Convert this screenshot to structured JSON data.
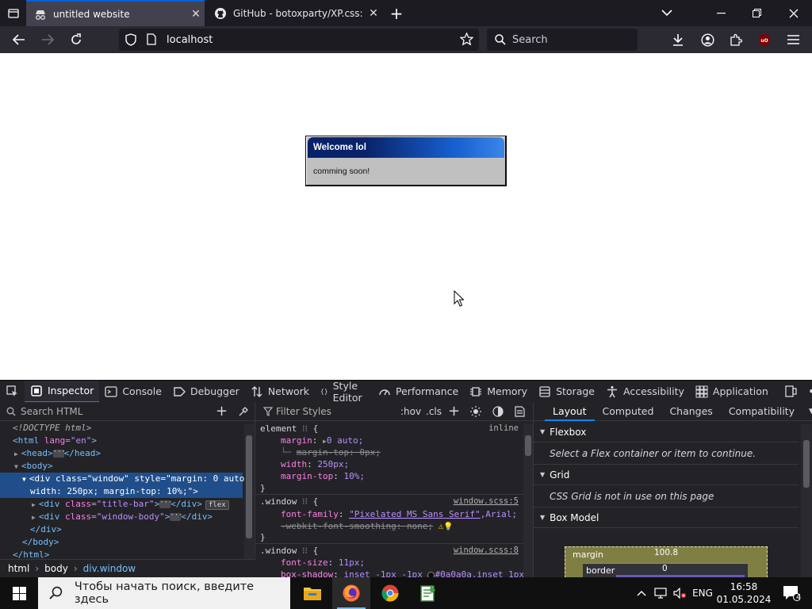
{
  "browser": {
    "tabs": [
      {
        "title": "untitled website",
        "active": true
      },
      {
        "title": "GitHub - botoxparty/XP.css: A C",
        "active": false
      }
    ],
    "url": "localhost",
    "search_placeholder": "Search"
  },
  "page": {
    "window_title": "Welcome lol",
    "window_body": "comming soon!"
  },
  "devtools": {
    "tools": [
      "Inspector",
      "Console",
      "Debugger",
      "Network",
      "Style Editor",
      "Performance",
      "Memory",
      "Storage",
      "Accessibility",
      "Application"
    ],
    "search_html_placeholder": "Search HTML",
    "filter_styles_placeholder": "Filter Styles",
    "hov": ":hov",
    "cls": ".cls",
    "markup": {
      "doctype": "<!DOCTYPE html>",
      "html_open": "<html",
      "html_lang_attr": "lang",
      "html_lang_val": "\"en\"",
      "head": "<head>",
      "head_close": "</head>",
      "body_open": "<body>",
      "div_open": "<div",
      "class_attr": "class",
      "window_class": "\"window\"",
      "style_attr": "style",
      "style_val_1": "\"margin: 0 auto;",
      "style_val_2": "width: 250px; margin-top: 10%;\">",
      "titlebar_class": "\"title-bar\"",
      "windowbody_class": "\"window-body\"",
      "div_close": "</div>",
      "flex_badge": "flex",
      "body_close": "</body>",
      "html_close": "</html>"
    },
    "breadcrumbs": [
      "html",
      "body",
      "div.window"
    ],
    "rules": {
      "element_selector": "element",
      "element_source": "inline",
      "margin_name": "margin",
      "margin_val": "0 auto;",
      "margin_top_struck": "margin-top: 0px;",
      "width_name": "width",
      "width_val": "250px;",
      "margin_top_name": "margin-top",
      "margin_top_val": "10%;",
      "window_selector": ".window",
      "window_src_1": "window.scss:5",
      "font_family_name": "font-family",
      "font_family_val_link": "\"Pixelated MS Sans Serif\"",
      "font_family_val_rest": ",Arial;",
      "webkit_smoothing": "-webkit-font-smoothing: none;",
      "window_src_2": "window.scss:8",
      "font_size_name": "font-size",
      "font_size_val": "11px;",
      "box_shadow_name": "box-shadow",
      "box_shadow_val": "inset -1px -1px",
      "box_shadow_color": "#0a0a0a",
      "box_shadow_rest": ",inset 1px"
    },
    "layout_tabs": [
      "Layout",
      "Computed",
      "Changes",
      "Compatibility"
    ],
    "layout": {
      "flexbox_title": "Flexbox",
      "flexbox_msg": "Select a Flex container or item to continue.",
      "grid_title": "Grid",
      "grid_msg": "CSS Grid is not in use on this page",
      "boxmodel_title": "Box Model",
      "margin_label": "margin",
      "margin_value": "100.8",
      "border_label": "border",
      "border_value": "0"
    }
  },
  "taskbar": {
    "search_placeholder": "Чтобы начать поиск, введите здесь",
    "lang": "ENG",
    "time": "16:58",
    "date": "01.05.2024",
    "notifications": "4"
  },
  "colors": {
    "accent": "#0a84ff",
    "xp_title_start": "#0a246a",
    "xp_title_end": "#3a86e8",
    "xp_window": "#c0c0c0"
  }
}
